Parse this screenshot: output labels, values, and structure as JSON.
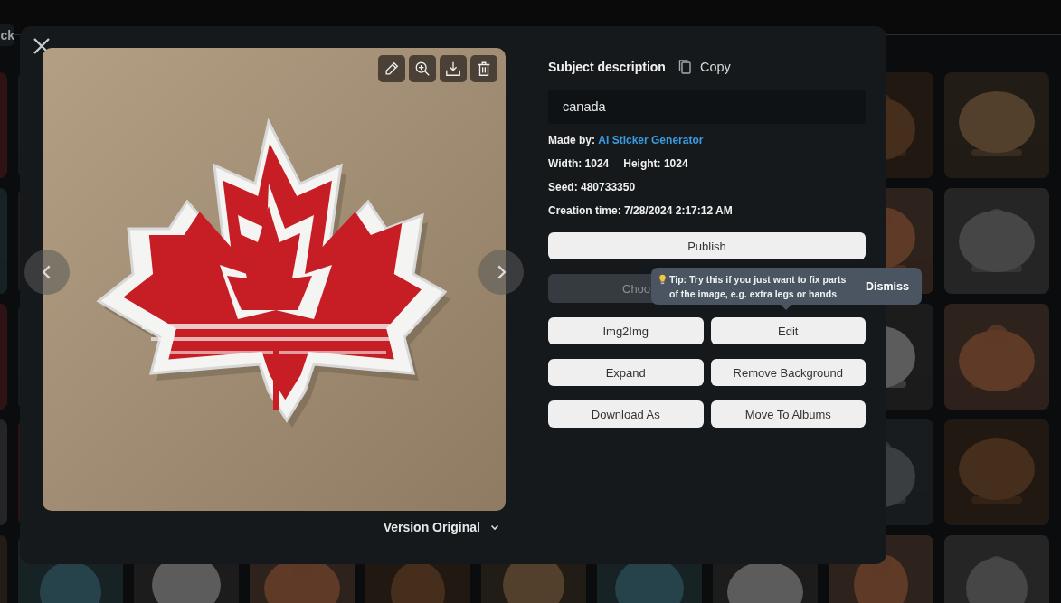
{
  "background": {
    "back_button": "ck",
    "tiles": [
      {
        "kind": "picture"
      },
      {
        "kind": "picture"
      },
      {
        "kind": "picture"
      },
      {
        "kind": "picture"
      },
      {
        "kind": "picture"
      },
      {
        "kind": "picture"
      },
      {
        "kind": "picture"
      },
      {
        "kind": "picture"
      },
      {
        "kind": "picture"
      },
      {
        "kind": "picture"
      },
      {
        "kind": "picture"
      },
      {
        "kind": "picture"
      },
      {
        "kind": "picture"
      },
      {
        "kind": "picture"
      },
      {
        "kind": "picture"
      },
      {
        "kind": "picture"
      },
      {
        "kind": "picture"
      },
      {
        "kind": "picture"
      },
      {
        "kind": "picture"
      },
      {
        "kind": "picture"
      },
      {
        "kind": "picture"
      },
      {
        "kind": "picture"
      },
      {
        "kind": "picture"
      },
      {
        "kind": "picture"
      },
      {
        "kind": "picture"
      },
      {
        "kind": "picture"
      }
    ]
  },
  "dialog": {
    "image": {
      "kind": "picture"
    },
    "version": "Version Original",
    "subject_label": "Subject description",
    "copy_label": "Copy",
    "subject_value": "canada",
    "details": [
      [
        {
          "label": "Made by:",
          "value": "AI Sticker Generator",
          "kind": "link"
        }
      ],
      [
        {
          "label": "Width:",
          "value": "1024",
          "kind": "text"
        },
        {
          "label": "Height:",
          "value": "1024",
          "kind": "text"
        }
      ],
      [
        {
          "label": "Seed:",
          "value": "480733350",
          "kind": "text"
        }
      ],
      [
        {
          "label": "Creation time:",
          "value": "7/28/2024 2:17:12 AM",
          "kind": "text"
        }
      ]
    ],
    "buttons": [
      [
        {
          "label": "Publish",
          "disabled": false
        }
      ],
      [
        {
          "label": "Choo",
          "disabled": true
        }
      ],
      [
        {
          "label": "Img2Img",
          "disabled": false
        },
        {
          "label": "Edit",
          "disabled": false
        }
      ],
      [
        {
          "label": "Expand",
          "disabled": false
        },
        {
          "label": "Remove Background",
          "disabled": false
        }
      ],
      [
        {
          "label": "Download As",
          "disabled": false
        },
        {
          "label": "Move To Albums",
          "disabled": false
        }
      ]
    ],
    "tooltip": {
      "text": "Tip: Try this if you just want to fix parts of the image, e.g. extra legs or hands",
      "dismiss": "Dismiss"
    }
  }
}
